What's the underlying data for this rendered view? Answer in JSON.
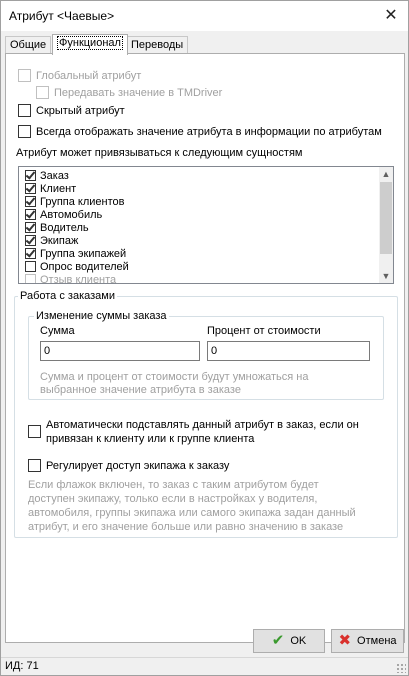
{
  "window": {
    "title": "Атрибут <Чаевые>",
    "close_icon": "close-icon"
  },
  "tabs": [
    {
      "label": "Общие",
      "active": false
    },
    {
      "label": "Функционал",
      "active": true
    },
    {
      "label": "Переводы",
      "active": false
    }
  ],
  "options": {
    "global_attribute": {
      "label": "Глобальный атрибут",
      "checked": false,
      "enabled": false
    },
    "pass_to_tmdriver": {
      "label": "Передавать значение в TMDriver",
      "checked": false,
      "enabled": false
    },
    "hidden_attribute": {
      "label": "Скрытый атрибут",
      "checked": false,
      "enabled": true
    },
    "always_show": {
      "label": "Всегда отображать значение атрибута в информации по атрибутам",
      "checked": false,
      "enabled": true
    }
  },
  "entities": {
    "label": "Атрибут может привязываться к следующим сущностям",
    "items": [
      {
        "label": "Заказ",
        "checked": true,
        "enabled": true
      },
      {
        "label": "Клиент",
        "checked": true,
        "enabled": true
      },
      {
        "label": "Группа клиентов",
        "checked": true,
        "enabled": true
      },
      {
        "label": "Автомобиль",
        "checked": true,
        "enabled": true
      },
      {
        "label": "Водитель",
        "checked": true,
        "enabled": true
      },
      {
        "label": "Экипаж",
        "checked": true,
        "enabled": true
      },
      {
        "label": "Группа экипажей",
        "checked": true,
        "enabled": true
      },
      {
        "label": "Опрос водителей",
        "checked": false,
        "enabled": true
      },
      {
        "label": "Отзыв клиента",
        "checked": false,
        "enabled": false
      }
    ]
  },
  "orders": {
    "title": "Работа с заказами",
    "change_sum": {
      "title": "Изменение суммы заказа",
      "sum_label": "Сумма",
      "sum_value": "0",
      "percent_label": "Процент от стоимости",
      "percent_value": "0",
      "hint_line1": "Сумма и процент от стоимости будут умножаться на",
      "hint_line2": "выбранное значение атрибута в заказе"
    },
    "auto_substitute": {
      "line1": "Автоматически подставлять данный атрибут в заказ, если он",
      "line2": "привязан к клиенту или к группе клиента",
      "checked": false
    },
    "crew_access": {
      "label": "Регулирует доступ экипажа к заказу",
      "checked": false,
      "hint_lines": [
        "Если флажок включен, то заказ с таким атрибутом будет",
        "доступен экипажу, только если в настройках у водителя,",
        "автомобиля, группы экипажа или самого экипажа задан данный",
        "атрибут, и его значение больше или равно значению в заказе"
      ]
    }
  },
  "buttons": {
    "ok": {
      "label": "OK",
      "icon": "checkmark-icon",
      "color": "#3a9a2e"
    },
    "cancel": {
      "label": "Отмена",
      "icon": "red-cross-icon",
      "color": "#d9302c"
    }
  },
  "status": {
    "id_text": "ИД: 71"
  }
}
